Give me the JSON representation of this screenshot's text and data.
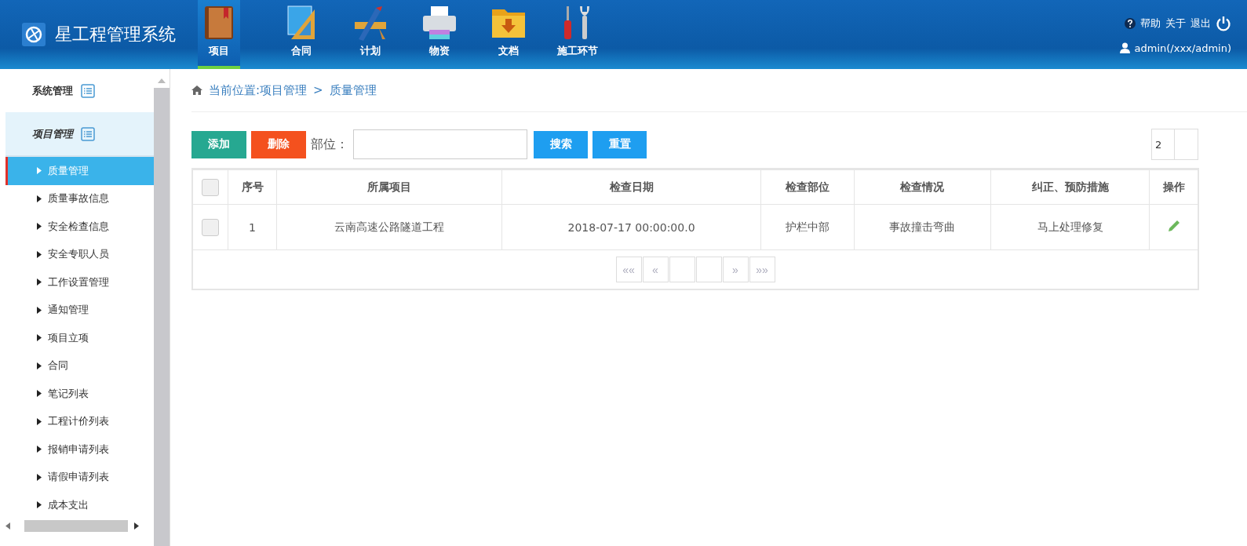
{
  "header": {
    "title": "星工程管理系统",
    "nav": [
      {
        "label": "项目",
        "kind": "book",
        "selected": true
      },
      {
        "label": "合同",
        "kind": "ruler",
        "selected": false
      },
      {
        "label": "计划",
        "kind": "pencil",
        "selected": false
      },
      {
        "label": "物资",
        "kind": "printer",
        "selected": false
      },
      {
        "label": "文档",
        "kind": "folder",
        "selected": false
      },
      {
        "label": "施工环节",
        "kind": "tools",
        "selected": false
      }
    ],
    "links": [
      "帮助",
      "关于",
      "退出"
    ],
    "user": "admin(/xxx/admin)"
  },
  "sidebar": {
    "sections": [
      {
        "label": "系统管理",
        "expanded": false
      },
      {
        "label": "项目管理",
        "expanded": true
      }
    ],
    "items": [
      {
        "label": "质量管理",
        "selected": true
      },
      {
        "label": "质量事故信息",
        "selected": false
      },
      {
        "label": "安全检查信息",
        "selected": false
      },
      {
        "label": "安全专职人员",
        "selected": false
      },
      {
        "label": "工作设置管理",
        "selected": false
      },
      {
        "label": "通知管理",
        "selected": false
      },
      {
        "label": "项目立项",
        "selected": false
      },
      {
        "label": "合同",
        "selected": false
      },
      {
        "label": "笔记列表",
        "selected": false
      },
      {
        "label": "工程计价列表",
        "selected": false
      },
      {
        "label": "报销申请列表",
        "selected": false
      },
      {
        "label": "请假申请列表",
        "selected": false
      },
      {
        "label": "成本支出",
        "selected": false
      }
    ]
  },
  "breadcrumb": {
    "path": "当前位置:项目管理",
    "separator": ">",
    "current": "质量管理"
  },
  "toolbar": {
    "add": "添加",
    "delete": "删除",
    "field_label": "部位：",
    "search": "搜索",
    "reset": "重置",
    "page_size": "2"
  },
  "table": {
    "select_all_checked": false,
    "columns": [
      "序号",
      "所属项目",
      "检查日期",
      "检查部位",
      "检查情况",
      "纠正、预防措施",
      "操作"
    ],
    "rows": [
      {
        "checked": false,
        "cells": [
          "1",
          "云南高速公路隧道工程",
          "2018-07-17 00:00:00.0",
          "护栏中部",
          "事故撞击弯曲",
          "马上处理修复"
        ]
      }
    ]
  },
  "pagination": {
    "first": "««",
    "prev": "«",
    "next": "»",
    "last": "»»"
  }
}
